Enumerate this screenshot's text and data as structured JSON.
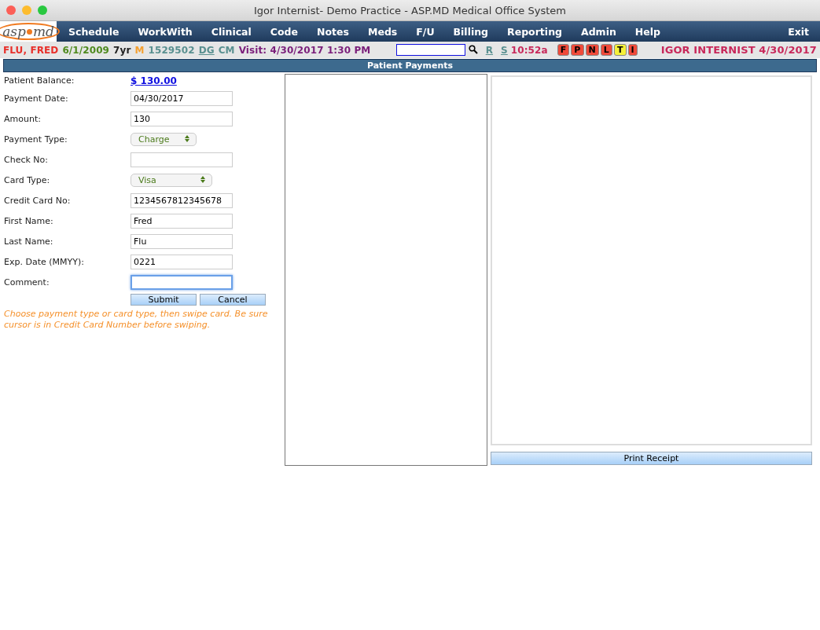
{
  "window": {
    "title": "Igor Internist- Demo Practice - ASP.MD Medical Office System"
  },
  "logo": {
    "text": "asp",
    "text2": "md"
  },
  "menu": [
    {
      "label": "Schedule"
    },
    {
      "label": "WorkWith"
    },
    {
      "label": "Clinical"
    },
    {
      "label": "Code"
    },
    {
      "label": "Notes"
    },
    {
      "label": "Meds"
    },
    {
      "label": "F/U"
    },
    {
      "label": "Billing"
    },
    {
      "label": "Reporting"
    },
    {
      "label": "Admin"
    },
    {
      "label": "Help"
    }
  ],
  "exit": "Exit",
  "patient_bar": {
    "items": [
      {
        "text": "FLU, FRED",
        "kind": "text",
        "color": "#e8302a"
      },
      {
        "text": "6/1/2009",
        "kind": "text",
        "color": "#4f8a1e"
      },
      {
        "text": "7yr",
        "kind": "text",
        "color": "#222222"
      },
      {
        "text": "M",
        "kind": "text",
        "color": "#f5a030"
      },
      {
        "text": "1529502",
        "kind": "text",
        "color": "#5a9090"
      },
      {
        "text": "DG",
        "kind": "link",
        "color": "#5a9090"
      },
      {
        "text": "CM",
        "kind": "text",
        "color": "#5a9090"
      },
      {
        "text": "Visit: 4/30/2017 1:30 PM",
        "kind": "text",
        "color": "#7a1e7a"
      }
    ],
    "search": {
      "kind": "empty"
    },
    "links": [
      "R",
      "S"
    ],
    "time": "10:52a",
    "flags": [
      {
        "label": "F",
        "color": "#f04a3a"
      },
      {
        "label": "P",
        "color": "#f04a3a"
      },
      {
        "label": "N",
        "color": "#f04a3a"
      },
      {
        "label": "L",
        "color": "#f04a3a"
      },
      {
        "label": "T",
        "color": "#f5f03a"
      },
      {
        "label": "I",
        "color": "#f04a3a"
      }
    ],
    "user": "IGOR INTERNIST 4/30/2017"
  },
  "section_title": "Patient Payments",
  "form": {
    "fields": [
      {
        "label": "Patient Balance:",
        "kind": "link",
        "value": "$ 130.00"
      },
      {
        "label": "Payment Date:",
        "kind": "input",
        "value": "04/30/2017",
        "focused": false
      },
      {
        "label": "Amount:",
        "kind": "input",
        "value": "130",
        "focused": false
      },
      {
        "label": "Payment Type:",
        "kind": "select",
        "value": "Charge"
      },
      {
        "label": "Check No:",
        "kind": "input",
        "focused": false
      },
      {
        "label": "Card Type:",
        "kind": "select",
        "value": "Visa"
      },
      {
        "label": "Credit Card No:",
        "kind": "input",
        "value": "1234567812345678",
        "focused": false
      },
      {
        "label": "First Name:",
        "kind": "input",
        "value": "Fred",
        "focused": false
      },
      {
        "label": "Last Name:",
        "kind": "input",
        "value": "Flu",
        "focused": false
      },
      {
        "label": "Exp. Date (MMYY):",
        "kind": "input",
        "value": "0221",
        "focused": false
      },
      {
        "label": "Comment:",
        "kind": "input",
        "focused": true
      }
    ],
    "buttons": [
      "Submit",
      "Cancel"
    ],
    "note": "Choose payment type or card type, then swipe card. Be sure cursor is in Credit Card Number before swiping."
  },
  "print_button": "Print Receipt"
}
